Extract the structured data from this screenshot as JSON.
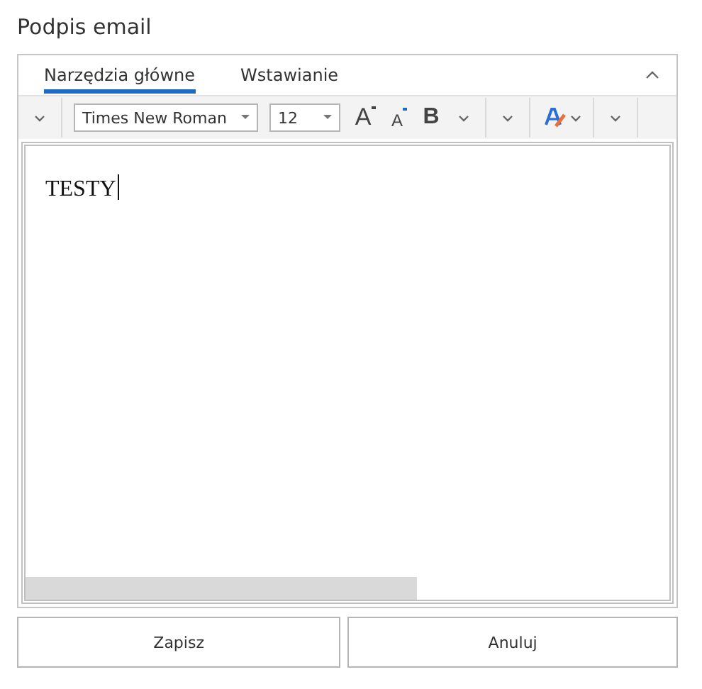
{
  "title": "Podpis email",
  "tabs": [
    {
      "label": "Narzędzia główne",
      "selected": true
    },
    {
      "label": "Wstawianie",
      "selected": false
    }
  ],
  "toolbar": [
    {
      "kind": "dropdown"
    },
    {
      "kind": "separator"
    },
    {
      "kind": "font",
      "value": "Times New Roman"
    },
    {
      "kind": "size",
      "value": "12"
    },
    {
      "kind": "grow",
      "label": "A"
    },
    {
      "kind": "shrink",
      "label": "A"
    },
    {
      "kind": "bold",
      "label": "B"
    },
    {
      "kind": "dropdown"
    },
    {
      "kind": "separator"
    },
    {
      "kind": "dropdown"
    },
    {
      "kind": "separator"
    },
    {
      "kind": "color"
    },
    {
      "kind": "separator"
    },
    {
      "kind": "dropdown"
    },
    {
      "kind": "separator"
    }
  ],
  "editor": {
    "text": "TESTY"
  },
  "buttons": [
    "Zapisz",
    "Anuluj"
  ]
}
